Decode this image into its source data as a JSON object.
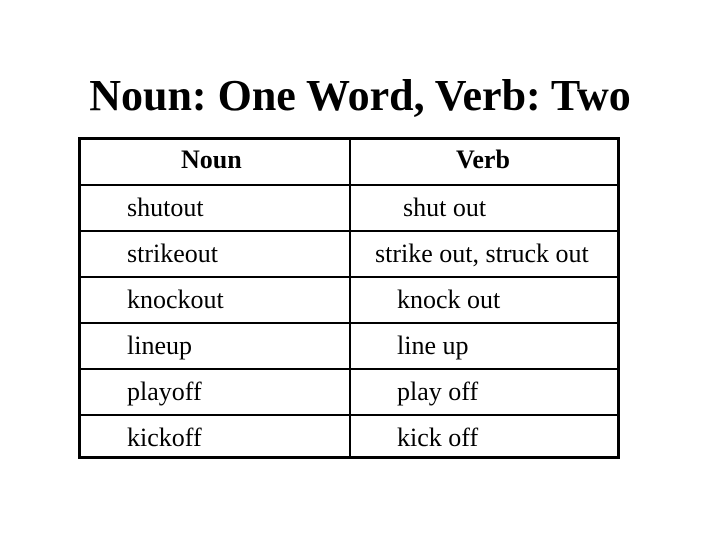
{
  "slide": {
    "title": "Noun: One Word, Verb: Two",
    "table": {
      "headers": {
        "noun": "Noun",
        "verb": "Verb"
      },
      "rows": [
        {
          "noun": "shutout",
          "verb": "shut out"
        },
        {
          "noun": "strikeout",
          "verb": "strike out, struck out"
        },
        {
          "noun": "knockout",
          "verb": "knock out"
        },
        {
          "noun": "lineup",
          "verb": "line up"
        },
        {
          "noun": "playoff",
          "verb": "play off"
        },
        {
          "noun": "kickoff",
          "verb": "kick off"
        }
      ]
    }
  }
}
